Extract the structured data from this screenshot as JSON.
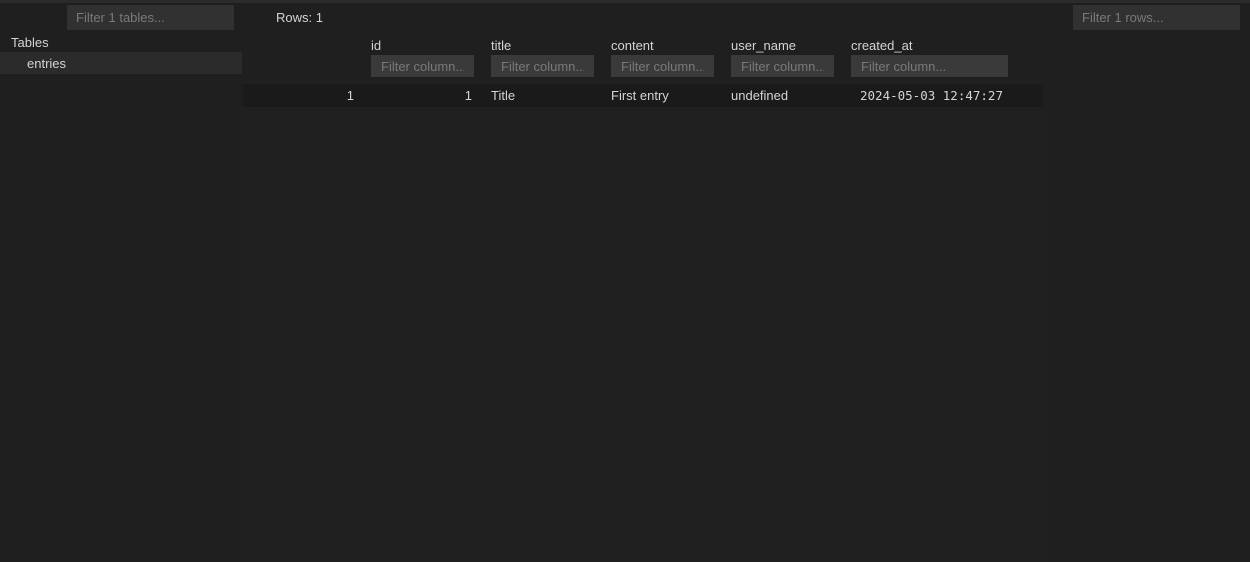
{
  "sidebar": {
    "filter_placeholder": "Filter 1 tables...",
    "heading": "Tables",
    "tables": [
      "entries"
    ]
  },
  "toolbar": {
    "rows_count": "Rows: 1",
    "rows_filter_placeholder": "Filter 1 rows..."
  },
  "grid": {
    "columns": [
      {
        "name": "id",
        "filter_placeholder": "Filter column..."
      },
      {
        "name": "title",
        "filter_placeholder": "Filter column..."
      },
      {
        "name": "content",
        "filter_placeholder": "Filter column..."
      },
      {
        "name": "user_name",
        "filter_placeholder": "Filter column..."
      },
      {
        "name": "created_at",
        "filter_placeholder": "Filter column..."
      }
    ],
    "rows": [
      {
        "index": "1",
        "cells": [
          "1",
          "Title",
          "First entry",
          "undefined",
          "2024-05-03 12:47:27"
        ]
      }
    ]
  }
}
